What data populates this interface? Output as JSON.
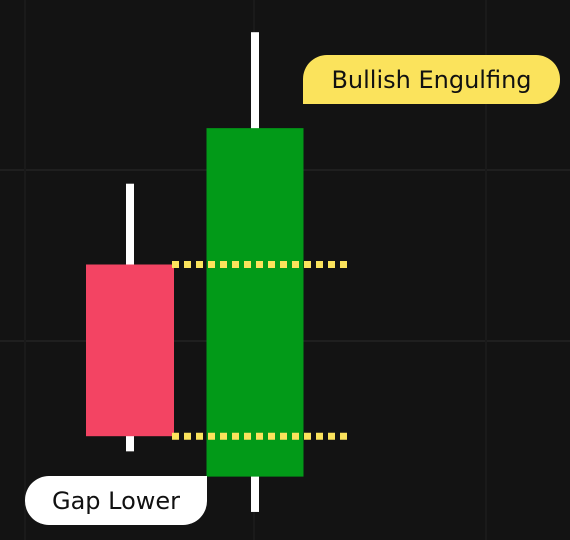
{
  "chart_data": {
    "type": "candlestick",
    "title": "",
    "xlabel": "",
    "ylabel": "",
    "grid": true,
    "ylim": [
      0,
      100
    ],
    "candles": [
      {
        "name": "bearish-candle",
        "open": 50,
        "close": 16,
        "high": 66,
        "low": 13,
        "color": "#f34463",
        "direction": "down"
      },
      {
        "name": "bullish-candle",
        "open": 8,
        "close": 77,
        "high": 96,
        "low": 1,
        "color": "#029a18",
        "direction": "up"
      }
    ],
    "levels": [
      {
        "name": "upper-level",
        "value": 50,
        "color": "#fbe35c",
        "style": "dotted"
      },
      {
        "name": "lower-level",
        "value": 16,
        "color": "#fbe35c",
        "style": "dotted"
      }
    ],
    "annotations": [
      {
        "text": "Bullish Engulfing",
        "target": "bullish-candle",
        "background": "#fbe35c"
      },
      {
        "text": "Gap Lower",
        "target": "bullish-candle",
        "background": "#ffffff"
      }
    ],
    "colors": {
      "background": "#131313",
      "grid": "#1f1f1f",
      "wick": "#ffffff"
    }
  },
  "labels": {
    "bullish_engulfing": "Bullish Engulfing",
    "gap_lower": "Gap Lower"
  }
}
